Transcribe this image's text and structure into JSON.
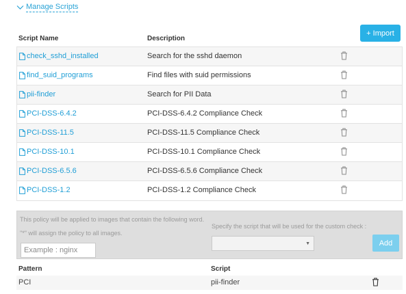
{
  "manage": {
    "label": "Manage Scripts",
    "icon": "chevron-down-icon"
  },
  "import": {
    "label": "+ Import"
  },
  "scripts_table": {
    "columns": {
      "name": "Script Name",
      "description": "Description"
    },
    "rows": [
      {
        "name": "check_sshd_installed",
        "description": "Search for the sshd daemon"
      },
      {
        "name": "find_suid_programs",
        "description": "Find files with suid permissions"
      },
      {
        "name": "pii-finder",
        "description": "Search for PII Data"
      },
      {
        "name": "PCI-DSS-6.4.2",
        "description": "PCI-DSS-6.4.2 Compliance Check"
      },
      {
        "name": "PCI-DSS-11.5",
        "description": "PCI-DSS-11.5 Compliance Check"
      },
      {
        "name": "PCI-DSS-10.1",
        "description": "PCI-DSS-10.1 Compliance Check"
      },
      {
        "name": "PCI-DSS-6.5.6",
        "description": "PCI-DSS-6.5.6 Compliance Check"
      },
      {
        "name": "PCI-DSS-1.2",
        "description": "PCI-DSS-1.2 Compliance Check"
      }
    ]
  },
  "policy": {
    "hint_line1": "This policy will be applied to images that contain the following word.",
    "hint_line2": "\"*\" will assign the policy to all images.",
    "pattern_placeholder": "Example : nginx",
    "script_hint": "Specify the script that will be used for the custom check :",
    "script_selected": "",
    "add_label": "Add"
  },
  "pattern_table": {
    "columns": {
      "pattern": "Pattern",
      "script": "Script"
    },
    "rows": [
      {
        "pattern": "PCI",
        "script": "pii-finder"
      }
    ]
  },
  "colors": {
    "link": "#1f9ed6",
    "import_button": "#29b1e6",
    "add_button_disabled": "#7ccfee",
    "policy_panel": "#dedede"
  },
  "icons": {
    "script_row": "file-icon",
    "delete": "trash-icon",
    "select_caret": "caret-down-icon"
  }
}
